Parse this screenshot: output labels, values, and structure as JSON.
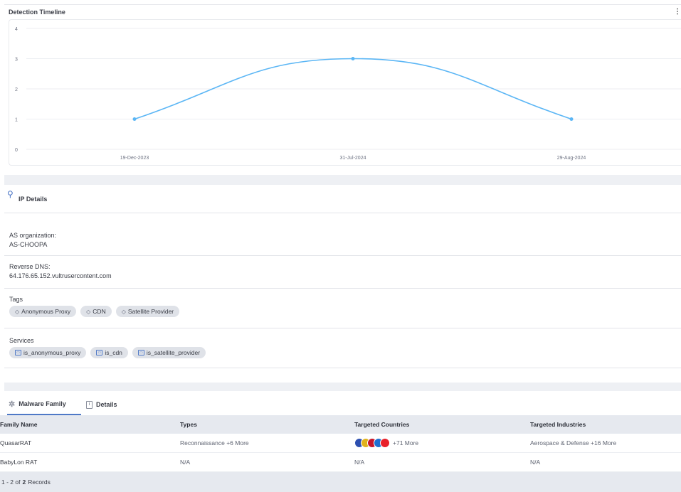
{
  "timeline": {
    "title": "Detection Timeline",
    "menu_glyph": "⋮"
  },
  "chart_data": {
    "type": "line",
    "categories": [
      "19-Dec-2023",
      "31-Jul-2024",
      "29-Aug-2024"
    ],
    "series": [
      {
        "values": [
          1,
          3,
          1
        ]
      }
    ],
    "yticks": [
      0,
      1,
      2,
      3,
      4
    ],
    "ylim": [
      0,
      4
    ],
    "grid": true,
    "smooth": true,
    "line_color": "#5bb6f5"
  },
  "ip_details": {
    "title": "IP Details",
    "icon": "location-pin-icon",
    "as_org_label": "AS organization:",
    "as_org_value": "AS-CHOOPA",
    "rdns_label": "Reverse DNS:",
    "rdns_value": "64.176.65.152.vultrusercontent.com",
    "tags_label": "Tags",
    "tags": [
      "Anonymous Proxy",
      "CDN",
      "Satellite Provider"
    ],
    "services_label": "Services",
    "services": [
      "is_anonymous_proxy",
      "is_cdn",
      "is_satellite_provider"
    ]
  },
  "tabs": {
    "malware": "Malware Family",
    "details": "Details"
  },
  "table": {
    "headers": [
      "Family Name",
      "Types",
      "Targeted Countries",
      "Targeted Industries"
    ],
    "rows": [
      {
        "name": "QuasarRAT",
        "types": "Reconnaissance +6 More",
        "countries": "+71 More",
        "industries": "Aerospace & Defense +16 More"
      },
      {
        "name": "BabyLon RAT",
        "types": "N/A",
        "countries": "N/A",
        "industries": "N/A"
      }
    ],
    "flag_colors": [
      "#2d4fb0",
      "#e0b21c",
      "#c7162b",
      "#1f6fd1",
      "#e8202a"
    ]
  },
  "footer": {
    "range": "1 - 2 of",
    "total": "2",
    "suffix": "Records"
  }
}
